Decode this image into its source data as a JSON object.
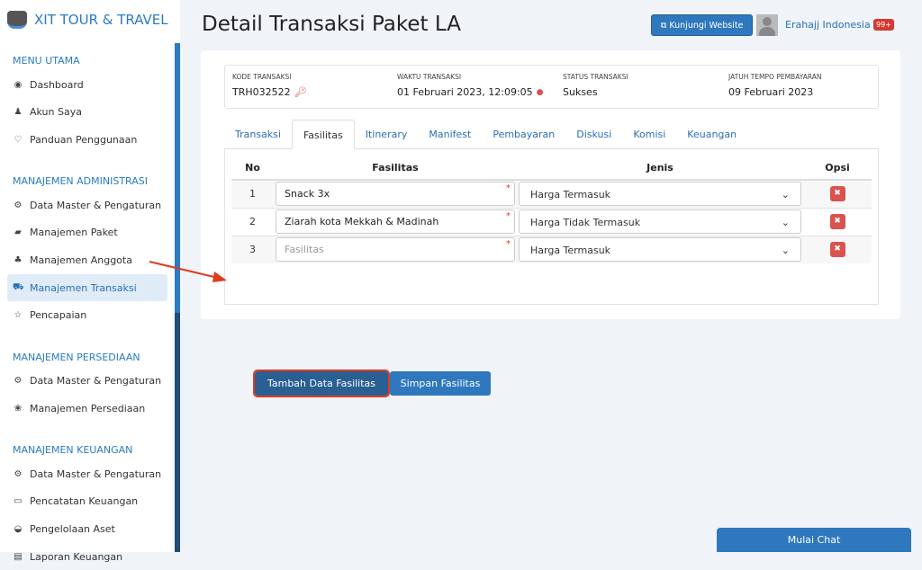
{
  "brand": "XIT TOUR & TRAVEL",
  "sidebar": {
    "sections": [
      {
        "title": "MENU UTAMA",
        "items": [
          {
            "label": "Dashboard",
            "icon": "globe-icon"
          },
          {
            "label": "Akun Saya",
            "icon": "user-icon"
          },
          {
            "label": "Panduan Penggunaan",
            "icon": "lightbulb-icon"
          }
        ]
      },
      {
        "title": "MANAJEMEN ADMINISTRASI",
        "items": [
          {
            "label": "Data Master & Pengaturan",
            "icon": "gears-icon"
          },
          {
            "label": "Manajemen Paket",
            "icon": "book-icon"
          },
          {
            "label": "Manajemen Anggota",
            "icon": "users-icon"
          },
          {
            "label": "Manajemen Transaksi",
            "icon": "cart-icon",
            "active": true
          },
          {
            "label": "Pencapaian",
            "icon": "star-icon"
          }
        ]
      },
      {
        "title": "MANAJEMEN PERSEDIAAN",
        "items": [
          {
            "label": "Data Master & Pengaturan",
            "icon": "gears-icon"
          },
          {
            "label": "Manajemen Persediaan",
            "icon": "cubes-icon"
          }
        ]
      },
      {
        "title": "MANAJEMEN KEUANGAN",
        "items": [
          {
            "label": "Data Master & Pengaturan",
            "icon": "gears-icon"
          },
          {
            "label": "Pencatatan Keuangan",
            "icon": "money-icon"
          },
          {
            "label": "Pengelolaan Aset",
            "icon": "hdd-icon"
          },
          {
            "label": "Laporan Keuangan",
            "icon": "report-icon"
          }
        ]
      }
    ]
  },
  "header": {
    "title": "Detail Transaksi Paket LA",
    "visit_label": "Kunjungi Website",
    "user": "Erahajj Indonesia",
    "badge": "99+"
  },
  "info": [
    {
      "label": "KODE TRANSAKSI",
      "value": "TRH032522"
    },
    {
      "label": "WAKTU TRANSAKSI",
      "value": "01 Februari 2023, 12:09:05"
    },
    {
      "label": "STATUS TRANSAKSI",
      "value": "Sukses"
    },
    {
      "label": "JATUH TEMPO PEMBAYARAN",
      "value": "09 Februari 2023"
    }
  ],
  "tabs": [
    "Transaksi",
    "Fasilitas",
    "Itinerary",
    "Manifest",
    "Pembayaran",
    "Diskusi",
    "Komisi",
    "Keuangan"
  ],
  "active_tab": "Fasilitas",
  "table": {
    "headers": [
      "No",
      "Fasilitas",
      "Jenis",
      "Opsi"
    ],
    "placeholder": "Fasilitas",
    "rows": [
      {
        "no": "1",
        "fasilitas": "Snack 3x",
        "jenis": "Harga Termasuk"
      },
      {
        "no": "2",
        "fasilitas": "Ziarah kota Mekkah & Madinah",
        "jenis": "Harga Tidak Termasuk"
      },
      {
        "no": "3",
        "fasilitas": "",
        "jenis": "Harga Termasuk"
      }
    ]
  },
  "buttons": {
    "add": "Tambah Data Fasilitas",
    "save": "Simpan Fasilitas"
  },
  "chat": "Mulai Chat",
  "colors": {
    "primary": "#2f78bd",
    "danger": "#d9534f",
    "highlight": "#e03a1e"
  }
}
